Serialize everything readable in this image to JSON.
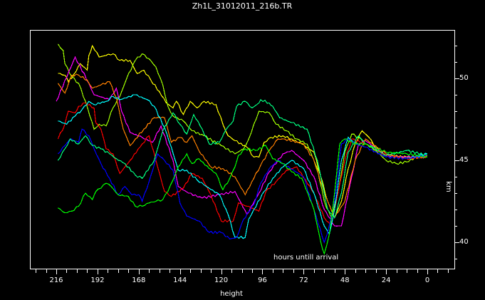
{
  "chart_data": {
    "type": "line",
    "title": "Zh1L_31012011_216b.TR",
    "xlabel": "height",
    "ylabel": "km",
    "annotation": "hours untill arrival",
    "xlim": [
      231,
      -16
    ],
    "ylim": [
      38.35,
      52.95
    ],
    "x_ticks": [
      216,
      192,
      168,
      144,
      120,
      96,
      72,
      48,
      24,
      0
    ],
    "x_tick_labels": [
      "216",
      "192",
      "168",
      "144",
      "120",
      "96",
      "72",
      "48",
      "24",
      "0"
    ],
    "x_minor_step": 6,
    "y_ticks": [
      50,
      45,
      40
    ],
    "y_tick_labels": [
      "50",
      "45",
      "40"
    ],
    "y_minor_step": 1,
    "grid": false,
    "series": [
      {
        "name": "yellow",
        "color": "#ffff00",
        "x": [
          215,
          211,
          209,
          207,
          202,
          198,
          197,
          195,
          191,
          187,
          183,
          179,
          173,
          169,
          165,
          161,
          156,
          152,
          148,
          146,
          142,
          138,
          134,
          130,
          123,
          119,
          116,
          112,
          105,
          101,
          98,
          95,
          91,
          84,
          79,
          73,
          66,
          62,
          58,
          54,
          50,
          46,
          42,
          38,
          34,
          30,
          24,
          12,
          0
        ],
        "y": [
          50.3,
          50.2,
          49.8,
          50.0,
          50.9,
          50.5,
          51.4,
          52.0,
          51.3,
          51.4,
          51.5,
          51.1,
          51.1,
          50.3,
          50.5,
          49.9,
          49.2,
          48.5,
          48.2,
          48.6,
          47.8,
          48.6,
          48.2,
          48.6,
          48.4,
          47.2,
          46.5,
          46.2,
          45.8,
          45.2,
          45.2,
          46.1,
          46.4,
          46.5,
          46.3,
          46.0,
          45.5,
          44.0,
          42.5,
          41.5,
          42.5,
          44.5,
          46.0,
          46.8,
          46.4,
          45.8,
          45.3,
          45.2,
          45.2
        ]
      },
      {
        "name": "lime",
        "color": "#a0ff00",
        "x": [
          215,
          212,
          211,
          207,
          203,
          199,
          194,
          191,
          187,
          183,
          179,
          175,
          170,
          166,
          162,
          158,
          154,
          151,
          148,
          142,
          137,
          130,
          120,
          112,
          107,
          104,
          101,
          98,
          92,
          88,
          82,
          76,
          70,
          64,
          60,
          56,
          52,
          48,
          44,
          40,
          36,
          30,
          24,
          18,
          12,
          6,
          0
        ],
        "y": [
          52.1,
          51.7,
          50.9,
          50.1,
          49.7,
          48.6,
          46.9,
          47.2,
          47.1,
          48.2,
          48.9,
          50.0,
          51.1,
          51.5,
          51.2,
          50.7,
          49.6,
          48.3,
          47.7,
          47.4,
          46.8,
          46.5,
          45.9,
          45.4,
          45.7,
          46.3,
          47.2,
          48.0,
          47.9,
          47.2,
          46.8,
          46.3,
          46.0,
          44.5,
          42.5,
          41.5,
          43.0,
          45.5,
          46.6,
          46.4,
          46.0,
          45.6,
          45.0,
          44.8,
          44.9,
          45.2,
          45.3
        ]
      },
      {
        "name": "magenta",
        "color": "#ff00ff",
        "x": [
          216,
          205,
          197,
          194,
          185,
          181,
          178,
          173,
          166,
          160,
          155,
          148,
          145,
          139,
          131,
          121,
          112,
          105,
          98,
          92,
          84,
          79,
          72,
          66,
          60,
          54,
          50,
          44,
          40,
          36,
          24,
          12,
          0
        ],
        "y": [
          48.6,
          51.3,
          49.7,
          49.0,
          48.7,
          49.4,
          48.0,
          46.7,
          46.4,
          46.1,
          47.1,
          45.0,
          43.4,
          43.0,
          42.7,
          42.9,
          43.1,
          41.7,
          43.0,
          44.3,
          45.4,
          45.6,
          45.0,
          44.0,
          42.0,
          41.0,
          41.0,
          44.0,
          46.0,
          46.2,
          45.3,
          45.2,
          45.3
        ]
      },
      {
        "name": "orange",
        "color": "#ff8000",
        "x": [
          215,
          211,
          207,
          203,
          198,
          195,
          190,
          185,
          181,
          177,
          173,
          170,
          165,
          159,
          153,
          149,
          144,
          140,
          137,
          133,
          126,
          119,
          112,
          106,
          101,
          97,
          92,
          87,
          83,
          72,
          66,
          60,
          54,
          48,
          42,
          36,
          24,
          12,
          0
        ],
        "y": [
          49.7,
          49.1,
          50.2,
          50.2,
          49.9,
          49.4,
          49.6,
          49.8,
          48.8,
          46.9,
          45.9,
          46.3,
          46.9,
          47.6,
          47.6,
          46.1,
          46.4,
          46.1,
          46.5,
          45.6,
          44.6,
          44.5,
          44.0,
          42.9,
          43.9,
          44.7,
          45.6,
          46.3,
          46.3,
          46.0,
          45.0,
          43.0,
          41.5,
          42.5,
          45.0,
          46.3,
          45.4,
          45.1,
          45.2
        ]
      },
      {
        "name": "red",
        "color": "#ff0000",
        "x": [
          215,
          211,
          209,
          205,
          203,
          199,
          194,
          193,
          190,
          187,
          183,
          179,
          173,
          166,
          162,
          158,
          153,
          149,
          142,
          137,
          131,
          126,
          120,
          113,
          110,
          105,
          98,
          94,
          88,
          82,
          76,
          66,
          60,
          56,
          52,
          48,
          44,
          36,
          24,
          12,
          0
        ],
        "y": [
          46.3,
          47.2,
          48.0,
          47.9,
          48.3,
          48.5,
          48.2,
          47.3,
          46.9,
          45.7,
          45.4,
          44.2,
          45.0,
          46.0,
          46.5,
          45.0,
          43.1,
          42.8,
          43.3,
          44.2,
          43.9,
          42.9,
          41.3,
          41.3,
          42.4,
          42.2,
          41.9,
          43.1,
          43.7,
          44.4,
          44.6,
          43.0,
          41.5,
          41.0,
          43.0,
          45.0,
          46.3,
          46.0,
          45.3,
          45.1,
          45.3
        ]
      },
      {
        "name": "cyan",
        "color": "#00ffff",
        "x": [
          215,
          210,
          205,
          201,
          197,
          194,
          187,
          183,
          179,
          170,
          163,
          159,
          153,
          149,
          145,
          140,
          134,
          130,
          121,
          116,
          112,
          106,
          104,
          101,
          95,
          90,
          84,
          79,
          72,
          66,
          60,
          57,
          54,
          50,
          46,
          42,
          36,
          24,
          12,
          0
        ],
        "y": [
          47.4,
          47.2,
          47.7,
          48.1,
          48.6,
          48.4,
          48.6,
          48.9,
          48.7,
          49.0,
          48.7,
          48.3,
          47.0,
          45.8,
          44.4,
          44.4,
          43.8,
          43.5,
          42.9,
          41.7,
          40.3,
          40.3,
          41.4,
          42.0,
          43.1,
          43.9,
          44.6,
          45.0,
          44.5,
          43.0,
          41.0,
          40.5,
          42.0,
          45.0,
          46.4,
          46.0,
          45.8,
          45.2,
          45.1,
          45.4
        ]
      },
      {
        "name": "blue",
        "color": "#0000ff",
        "x": [
          215,
          211,
          208,
          203,
          201,
          197,
          194,
          190,
          185,
          180,
          176,
          172,
          168,
          166,
          162,
          157,
          153,
          148,
          144,
          140,
          133,
          127,
          120,
          115,
          111,
          107,
          101,
          97,
          92,
          87,
          72,
          66,
          60,
          58,
          54,
          50,
          46,
          42,
          36,
          24,
          12,
          0
        ],
        "y": [
          45.4,
          45.9,
          46.3,
          46.1,
          46.9,
          46.5,
          45.7,
          44.8,
          43.9,
          42.9,
          43.4,
          42.9,
          42.9,
          42.5,
          43.7,
          45.4,
          45.0,
          44.4,
          42.4,
          41.6,
          41.3,
          40.6,
          40.6,
          40.2,
          40.3,
          41.4,
          42.3,
          43.6,
          44.5,
          45.0,
          44.0,
          42.0,
          40.0,
          40.6,
          42.5,
          46.0,
          46.3,
          46.0,
          45.8,
          45.2,
          45.1,
          45.3
        ]
      },
      {
        "name": "spring-green",
        "color": "#00ff80",
        "x": [
          215,
          211,
          208,
          203,
          199,
          195,
          190,
          185,
          181,
          176,
          170,
          166,
          159,
          154,
          148,
          144,
          140,
          136,
          131,
          127,
          121,
          117,
          113,
          111,
          106,
          102,
          98,
          97,
          92,
          90,
          86,
          79,
          70,
          64,
          58,
          54,
          50,
          46,
          40,
          36,
          24,
          12,
          0
        ],
        "y": [
          45.0,
          45.7,
          46.3,
          46.0,
          46.5,
          45.9,
          45.7,
          45.4,
          45.1,
          44.8,
          44.1,
          43.9,
          45.0,
          46.8,
          47.9,
          47.2,
          46.6,
          47.8,
          46.9,
          46.0,
          46.1,
          46.9,
          47.4,
          48.3,
          48.6,
          48.2,
          48.5,
          48.7,
          48.5,
          48.3,
          47.6,
          47.3,
          46.9,
          45.0,
          42.0,
          41.5,
          43.0,
          45.5,
          46.5,
          46.0,
          45.3,
          45.6,
          45.3
        ]
      },
      {
        "name": "green",
        "color": "#00ff00",
        "x": [
          215,
          211,
          207,
          203,
          199,
          195,
          193,
          190,
          187,
          184,
          180,
          174,
          170,
          166,
          162,
          158,
          154,
          151,
          148,
          145,
          140,
          137,
          133,
          127,
          123,
          119,
          115,
          112,
          110,
          106,
          100,
          94,
          90,
          84,
          79,
          73,
          66,
          62,
          60,
          57,
          54,
          51,
          48,
          42,
          36,
          24,
          12,
          0
        ],
        "y": [
          42.1,
          41.8,
          41.9,
          42.2,
          43.0,
          42.6,
          43.1,
          43.3,
          43.6,
          43.4,
          42.9,
          42.8,
          42.2,
          42.2,
          42.4,
          42.5,
          42.6,
          43.1,
          43.8,
          44.6,
          45.4,
          44.8,
          45.1,
          44.5,
          44.2,
          43.2,
          43.9,
          44.6,
          45.3,
          45.7,
          45.6,
          45.9,
          45.1,
          44.8,
          44.3,
          43.9,
          42.0,
          40.0,
          39.3,
          40.5,
          43.0,
          46.0,
          46.3,
          46.0,
          46.0,
          45.5,
          45.4,
          45.2
        ]
      }
    ]
  }
}
